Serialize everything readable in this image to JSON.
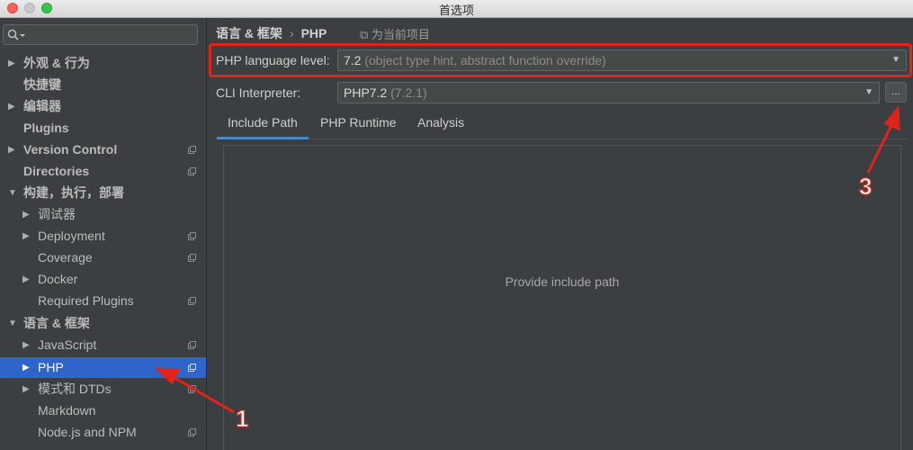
{
  "window": {
    "title": "首选项"
  },
  "colors": {
    "accent": "#2f65ca",
    "annotation": "#e2231a",
    "tab_underline": "#4a88c7"
  },
  "sidebar": {
    "search_icon": "search-icon",
    "items": [
      {
        "label": "外观 & 行为",
        "arrow": "▶"
      },
      {
        "label": "快捷键"
      },
      {
        "label": "编辑器",
        "arrow": "▶"
      },
      {
        "label": "Plugins"
      },
      {
        "label": "Version Control",
        "arrow": "▶"
      },
      {
        "label": "Directories"
      },
      {
        "label": "构建，执行，部署",
        "arrow": "▼"
      },
      {
        "label": "调试器",
        "arrow": "▶"
      },
      {
        "label": "Deployment",
        "arrow": "▶"
      },
      {
        "label": "Coverage"
      },
      {
        "label": "Docker",
        "arrow": "▶"
      },
      {
        "label": "Required Plugins"
      },
      {
        "label": "语言 & 框架",
        "arrow": "▼"
      },
      {
        "label": "JavaScript",
        "arrow": "▶"
      },
      {
        "label": "PHP",
        "arrow": "▶"
      },
      {
        "label": "模式和 DTDs",
        "arrow": "▶"
      },
      {
        "label": "Markdown"
      },
      {
        "label": "Node.js and NPM"
      }
    ]
  },
  "main": {
    "breadcrumb": {
      "parent": "语言 & 框架",
      "separator": "›",
      "current": "PHP"
    },
    "current_project_label": "⧉ 为当前项目",
    "php_level": {
      "label": "PHP language level:",
      "value": "7.2",
      "detail": "(object type hint, abstract function override)"
    },
    "cli": {
      "label": "CLI Interpreter:",
      "value": "PHP7.2",
      "detail": "(7.2.1)"
    },
    "more_button": "...",
    "tabs": [
      "Include Path",
      "PHP Runtime",
      "Analysis"
    ],
    "empty_text": "Provide include path"
  },
  "annotations": {
    "one": "1",
    "three": "3"
  }
}
